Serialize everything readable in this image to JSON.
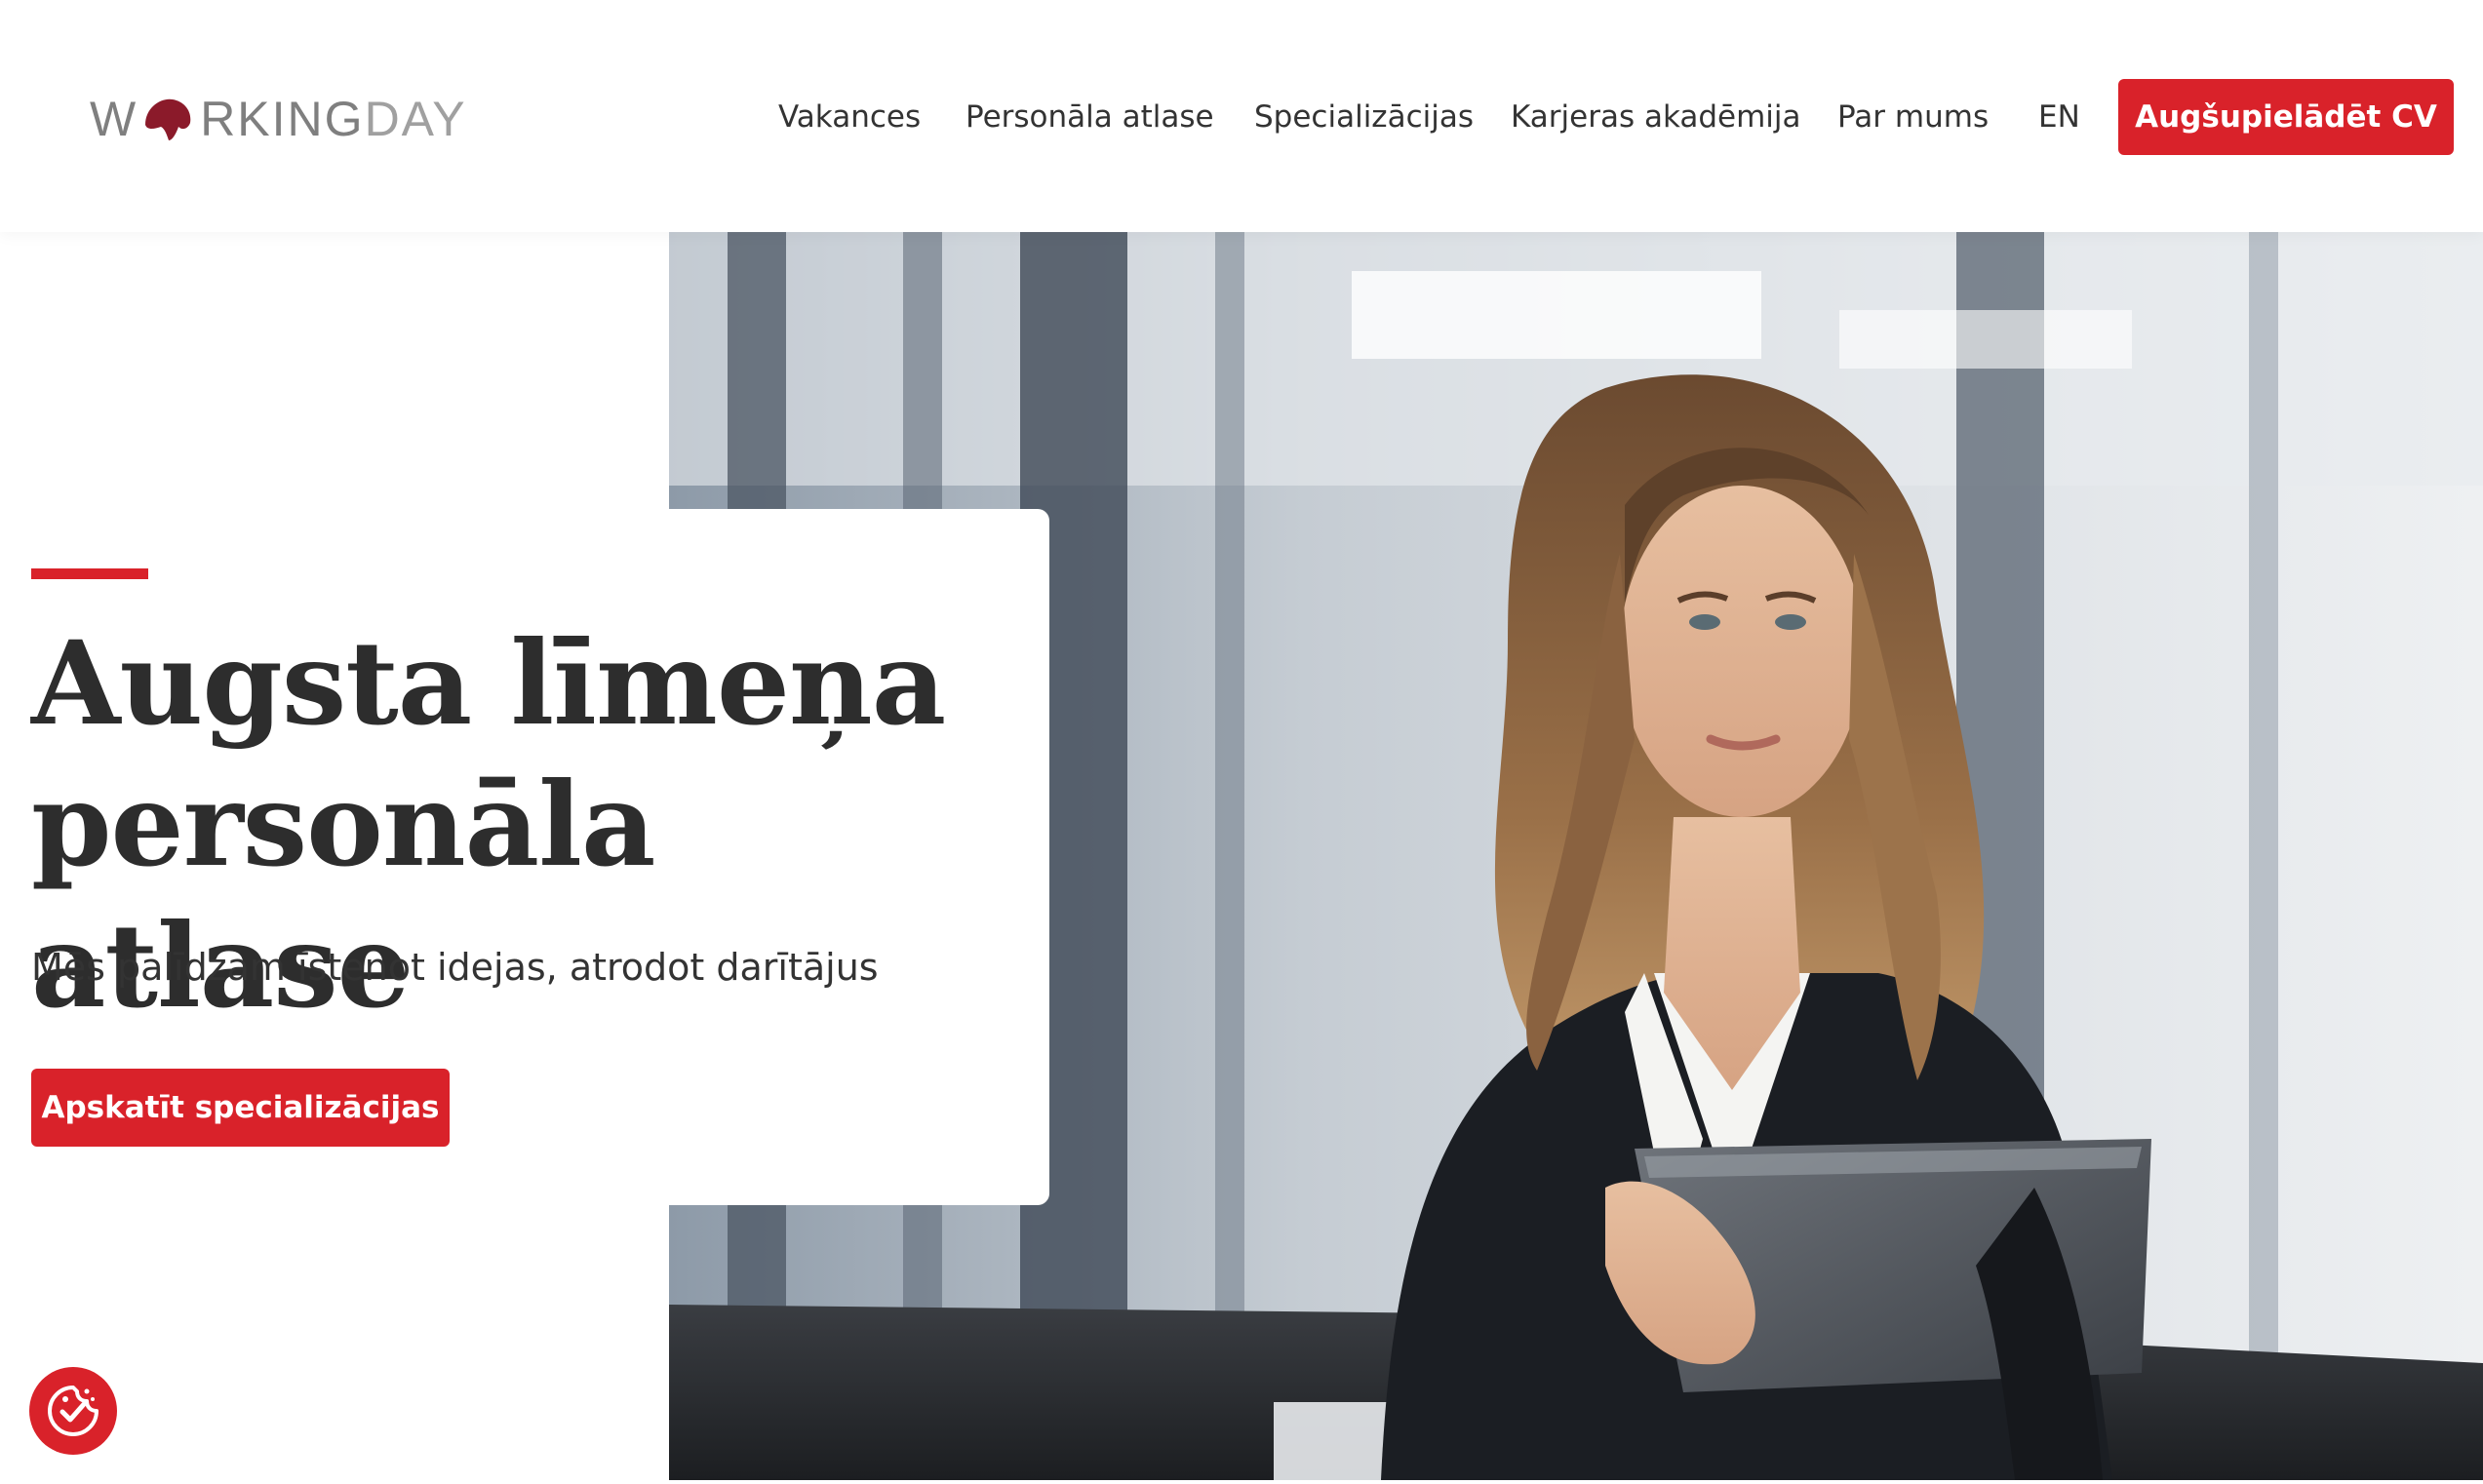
{
  "header": {
    "logo": {
      "part1": "W",
      "part2": "RKING",
      "part3": "DAY",
      "brand_color": "#8b1a2a"
    },
    "nav": [
      {
        "label": "Vakances"
      },
      {
        "label": "Personāla atlase"
      },
      {
        "label": "Specializācijas"
      },
      {
        "label": "Karjeras akadēmija"
      },
      {
        "label": "Par mums"
      },
      {
        "label": "EN"
      }
    ],
    "cta_label": "Augšupielādēt CV"
  },
  "hero": {
    "title_line1": "Augsta līmeņa",
    "title_line2": "personāla atlase",
    "subtitle": "Mēs palīdzam īstenot idejas, atrodot darītājus",
    "cta_label": "Apskatīt specializācijas",
    "image": "businesswoman-with-tablet-photo"
  },
  "cookie_badge": {
    "icon": "cookie-consent-icon"
  },
  "colors": {
    "accent": "#d9222a",
    "text_dark": "#2d2d2d",
    "text_body": "#333333"
  }
}
